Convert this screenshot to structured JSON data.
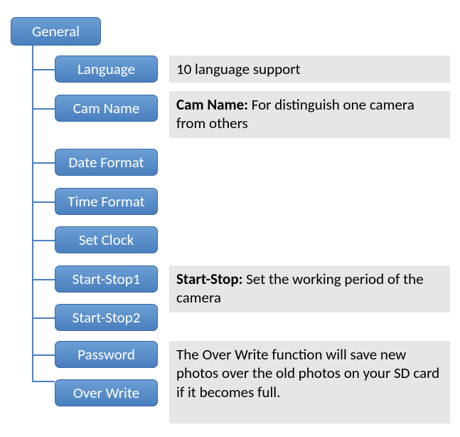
{
  "root": {
    "label": "General"
  },
  "items": [
    {
      "label": "Language"
    },
    {
      "label": "Cam Name"
    },
    {
      "label": "Date Format"
    },
    {
      "label": "Time Format"
    },
    {
      "label": "Set Clock"
    },
    {
      "label": "Start-Stop1"
    },
    {
      "label": "Start-Stop2"
    },
    {
      "label": "Password"
    },
    {
      "label": "Over Write"
    }
  ],
  "descriptions": {
    "language": "10 language support",
    "camname_label": "Cam Name:",
    "camname_text": " For distinguish one camera from others",
    "startstop_label": "Start-Stop:",
    "startstop_text": " Set the working period of the camera",
    "overwrite": "The Over Write function will save new photos over the old photos on your SD card if it becomes full."
  }
}
